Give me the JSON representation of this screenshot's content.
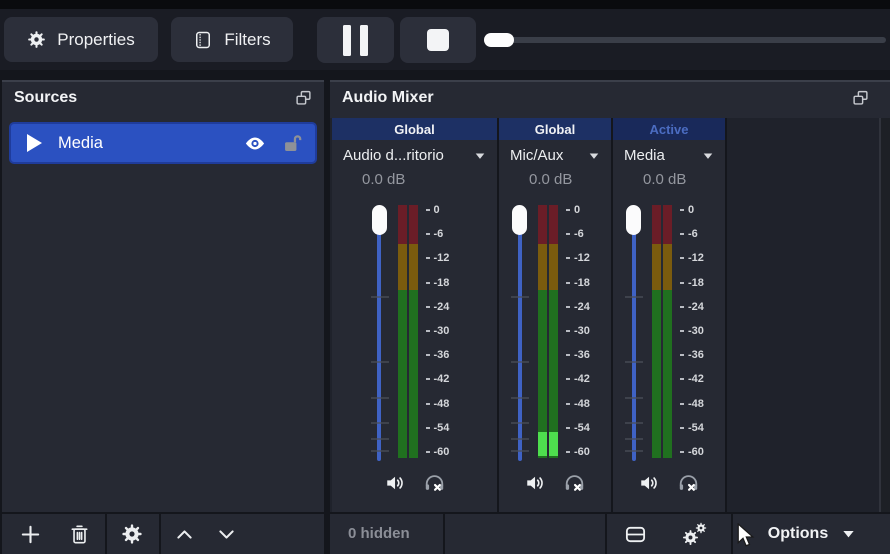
{
  "toolbar": {
    "properties_label": "Properties",
    "filters_label": "Filters",
    "pause_icon": "pause-icon",
    "stop_icon": "stop-icon",
    "seek_slider": {
      "position_percent": 1
    }
  },
  "sources_panel": {
    "title": "Sources",
    "items": [
      {
        "label": "Media",
        "selected": true,
        "type_icon": "play-icon",
        "visible": true,
        "locked": false
      }
    ]
  },
  "mixer_panel": {
    "title": "Audio Mixer",
    "tabs": [
      {
        "label": "Global",
        "active": false
      },
      {
        "label": "Global",
        "active": false
      },
      {
        "label": "Active",
        "active": true
      }
    ],
    "scale_ticks": [
      "0",
      "-6",
      "-12",
      "-18",
      "-24",
      "-30",
      "-36",
      "-42",
      "-48",
      "-54",
      "-60"
    ],
    "channels": [
      {
        "name": "Audio d...ritorio",
        "volume": "0.0 dB",
        "slider_db": 0.0,
        "level_db": null,
        "muted": false,
        "monitor_off": true
      },
      {
        "name": "Mic/Aux",
        "volume": "0.0 dB",
        "slider_db": 0.0,
        "level_db": -55,
        "muted": false,
        "monitor_off": true
      },
      {
        "name": "Media",
        "volume": "0.0 dB",
        "slider_db": 0.0,
        "level_db": null,
        "muted": false,
        "monitor_off": true
      }
    ],
    "footer": {
      "hidden_label": "0 hidden",
      "options_label": "Options"
    }
  },
  "colors": {
    "selection_blue": "#2b51c1",
    "slider_blue": "#3f62c4",
    "tab_bg": "#1d3064",
    "tab_active_bg": "#19295a",
    "tab_active_text": "#4b6cc1",
    "meter_dim_red": "#6b1d27",
    "meter_dim_amber": "#7b5b0e",
    "meter_dim_green": "#20701f",
    "meter_active_green": "#4ede4e"
  }
}
